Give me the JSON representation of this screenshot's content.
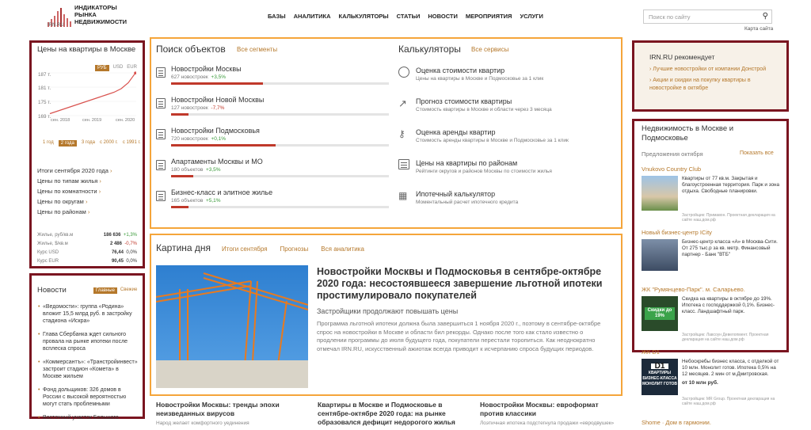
{
  "logo": {
    "lines": [
      "ИНДИКАТОРЫ",
      "РЫНКА",
      "НЕДВИЖИМОСТИ"
    ],
    "sub": "IRN.RU"
  },
  "nav": [
    "БАЗЫ",
    "АНАЛИТИКА",
    "КАЛЬКУЛЯТОРЫ",
    "СТАТЬИ",
    "НОВОСТИ",
    "МЕРОПРИЯТИЯ",
    "УСЛУГИ"
  ],
  "search": {
    "placeholder": "Поиск по сайту",
    "map": "Карта сайта"
  },
  "prices": {
    "title": "Цены на квартиры в Москве",
    "currencies": [
      "РУБ",
      "USD",
      "EUR"
    ],
    "yticks": [
      "187 т.",
      "181 т.",
      "175 т.",
      "169 т."
    ],
    "xticks": [
      "сен. 2018",
      "сен. 2019",
      "сен. 2020"
    ],
    "periods": [
      "1 год",
      "2 года",
      "3 года",
      "с 2000 г.",
      "с 1991 г."
    ],
    "links": [
      "Итоги сентября 2020 года",
      "Цены по типам жилья",
      "Цены по комнатности",
      "Цены по округам",
      "Цены по районам"
    ],
    "stats": [
      {
        "label": "Жилье, руб/кв.м",
        "value": "186 636",
        "change": "+1,3%"
      },
      {
        "label": "Жилье, $/кв.м",
        "value": "2 486",
        "change": "-0,7%"
      },
      {
        "label": "Курс USD",
        "value": "76,44",
        "change": "0,0%"
      },
      {
        "label": "Курс EUR",
        "value": "90,45",
        "change": "0,0%"
      }
    ]
  },
  "chart_data": {
    "type": "line",
    "x": [
      "сен. 2018",
      "",
      "",
      "",
      "",
      "",
      "сен. 2019",
      "",
      "",
      "",
      "",
      "",
      "сен. 2020"
    ],
    "values": [
      169.5,
      170.5,
      171.5,
      172.5,
      173.5,
      174.5,
      175.5,
      176.5,
      177.5,
      178.5,
      180,
      182.5,
      186.6
    ],
    "ylim": [
      168,
      188
    ]
  },
  "news": {
    "title": "Новости",
    "tabs": [
      "Главные",
      "Свежие"
    ],
    "items": [
      "«Ведомости»: группа «Родина» вложит 15,5 млрд руб. в застройку стадиона «Искра»",
      "Глава Сбербанка ждет сильного провала на рынке ипотеки после всплеска спроса",
      "«Коммерсантъ»: «Транстройинвест» застроит стадион «Комета» в Москве жильем",
      "Фонд дольщиков: 326 домов в России с высокой вероятностью могут стать проблемными",
      "Восточный участок Большого"
    ]
  },
  "search_objects": {
    "title": "Поиск объектов",
    "link": "Все сегменты",
    "items": [
      {
        "title": "Новостройки Москвы",
        "count": "627 новостроек",
        "change": "+3,5%",
        "fill": 0.42
      },
      {
        "title": "Новостройки Новой Москвы",
        "count": "127 новостроек",
        "change": "-7,7%",
        "fill": 0.08
      },
      {
        "title": "Новостройки Подмосковья",
        "count": "720 новостроек",
        "change": "+0,1%",
        "fill": 0.48
      },
      {
        "title": "Апартаменты Москвы и МО",
        "count": "180 объектов",
        "change": "+3,5%",
        "fill": 0.1
      },
      {
        "title": "Бизнес-класс и элитное жилье",
        "count": "165 объектов",
        "change": "+5,1%",
        "fill": 0.08
      }
    ]
  },
  "calcs": {
    "title": "Калькуляторы",
    "link": "Все сервисы",
    "items": [
      {
        "title": "Оценка стоимости квартир",
        "sub": "Цены на квартиры в Москве и Подмосковье за 1 клик"
      },
      {
        "title": "Прогноз стоимости квартиры",
        "sub": "Стоимость квартиры в Москве и области через 3 месяца"
      },
      {
        "title": "Оценка аренды квартир",
        "sub": "Стоимость аренды квартиры в Москве и Подмосковье за 1 клик"
      },
      {
        "title": "Цены на квартиры по районам",
        "sub": "Рейтинги округов и районов Москвы по стоимости жилья"
      },
      {
        "title": "Ипотечный калькулятор",
        "sub": "Моментальный расчет ипотечного кредита"
      }
    ]
  },
  "day": {
    "title": "Картина дня",
    "links": [
      "Итоги сентября",
      "Прогнозы",
      "Вся аналитика"
    ],
    "headline": "Новостройки Москвы и Подмосковья в сентябре-октябре 2020 года: несостоявшееся завершение льготной ипотеки простимулировало покупателей",
    "sub": "Застройщики продолжают повышать цены",
    "text": "Программа льготной ипотеки должна была завершиться 1 ноября 2020 г., поэтому в сентябре-октябре спрос на новостройки в Москве и области бил рекорды. Однако после того как стало известно о продлении программы до июля будущего года, покупатели перестали торопиться. Как неоднократно отмечал IRN.RU, искусственный ажиотаж всегда приводит к исчерпанию спроса будущих периодов."
  },
  "bottom": [
    {
      "title": "Новостройки Москвы: тренды эпохи неизведанных вирусов",
      "sub": "Народ желает комфортного уединения"
    },
    {
      "title": "Квартиры в Москве и Подмосковье в сентябре-октябре 2020 года: на рынке образовался дефицит недорогого жилья",
      "sub": ""
    },
    {
      "title": "Новостройки Москвы: евроформат против классики",
      "sub": "Лоэтичная ипотека подстегнула продажи «евродвушек»"
    }
  ],
  "recommends": {
    "title": "IRN.RU рекомендует",
    "items": [
      "Лучшие новостройки от компании Донстрой",
      "Акции и скидки на покупку квартиры в новостройке в октябре"
    ]
  },
  "realty": {
    "title": "Недвижимость в Москве и Подмосковье",
    "sub": "Предложения октября",
    "show": "Показать все",
    "items": [
      {
        "name": "Vnukovo Country Club",
        "text": "Квартиры от 77 кв.м. Закрытая и благоустроенная территория. Парк и зона отдыха. Свободные планировки.",
        "dev": "Застройщик: Примавон. Проектная декларация на сайте наш.дом.рф"
      },
      {
        "name": "Новый бизнес-центр ICity",
        "text": "Бизнес-центр класса «А» в Москва-Сити. От 275 тыс.р за кв. метр. Финансовый партнер - Банк \"ВТБ\"",
        "dev": ""
      },
      {
        "name": "ЖК \"Румянцево-Парк\". м. Саларьево.",
        "text": "Скидка на квартиры в октябре до 19%. Ипотека с господдержкой 0,1%. Бизнес-класс. Ландшафтный парк.",
        "dev": "Застройщик: Лавсоун Девелопмент. Проектная декларация на сайте наш.дом.рф",
        "badge": "Скидки до 19%"
      },
      {
        "name": "ЖК D1",
        "text": "Небоскребы бизнес класса, с отделкой от 10 млн. Монолит готов. Ипотека 0,5% на 12 месяцев. 2 мин от м.Дмитровская.",
        "price": "от 10 млн руб.",
        "dev": "Застройщик: МR Group. Проектная декларация на сайте наш.дом.рф",
        "badge": "КВАРТИРЫ БИЗНЕС-КЛАССА МОНОЛИТ ГОТОВ"
      },
      {
        "name": "Shome · Дом в гармонии.",
        "text": "",
        "dev": ""
      }
    ]
  }
}
